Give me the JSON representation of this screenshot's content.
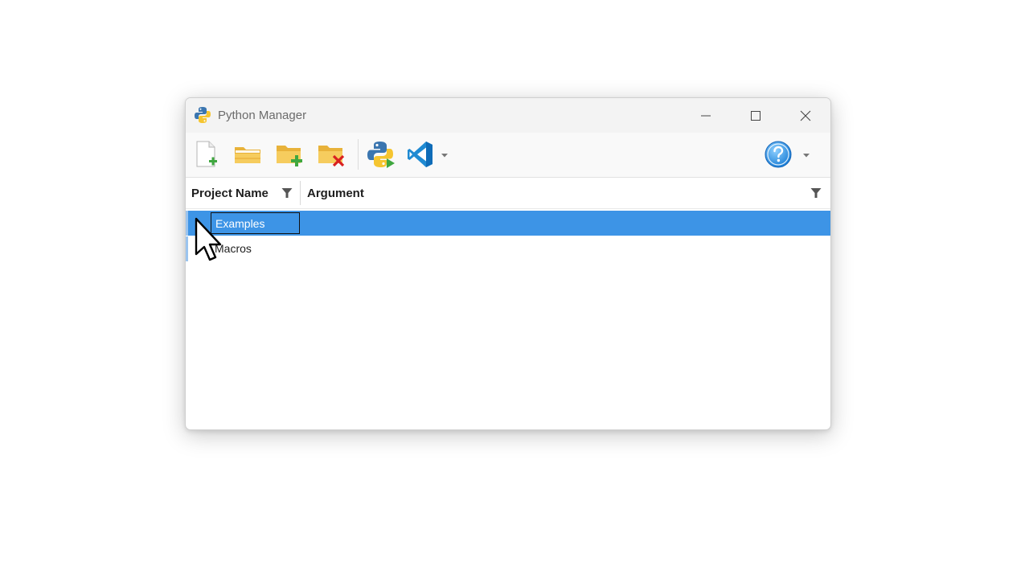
{
  "window": {
    "title": "Python Manager"
  },
  "toolbar": {
    "buttons": [
      {
        "name": "new-project",
        "icon": "new-file-icon"
      },
      {
        "name": "open-folder",
        "icon": "folder-open-icon"
      },
      {
        "name": "add-folder",
        "icon": "folder-add-icon"
      },
      {
        "name": "delete-folder",
        "icon": "folder-delete-icon"
      },
      {
        "name": "run-python",
        "icon": "python-run-icon"
      },
      {
        "name": "open-vscode",
        "icon": "vscode-icon"
      },
      {
        "name": "help",
        "icon": "help-icon"
      }
    ]
  },
  "grid": {
    "columns": [
      "Project Name",
      "Argument"
    ],
    "rows": [
      {
        "name": "Examples",
        "argument": "",
        "selected": true,
        "editing": true
      },
      {
        "name": "Macros",
        "argument": "",
        "selected": false,
        "editing": false
      }
    ]
  },
  "colors": {
    "selection": "#3d94e6",
    "title_text": "#6b6b6b"
  }
}
